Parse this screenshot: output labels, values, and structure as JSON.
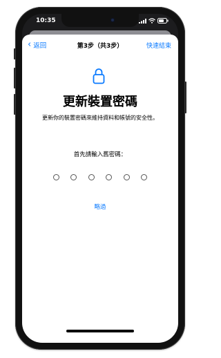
{
  "status": {
    "time": "10:35"
  },
  "nav": {
    "back_label": "返回",
    "title": "第3步（共3步）",
    "action_label": "快速結束"
  },
  "main": {
    "heading": "更新裝置密碼",
    "description": "更新你的裝置密碼來維持資料和帳號的安全性。",
    "prompt": "首先請輸入舊密碼：",
    "passcode_length": 6,
    "skip_label": "略過"
  },
  "colors": {
    "accent": "#0a7aff"
  }
}
